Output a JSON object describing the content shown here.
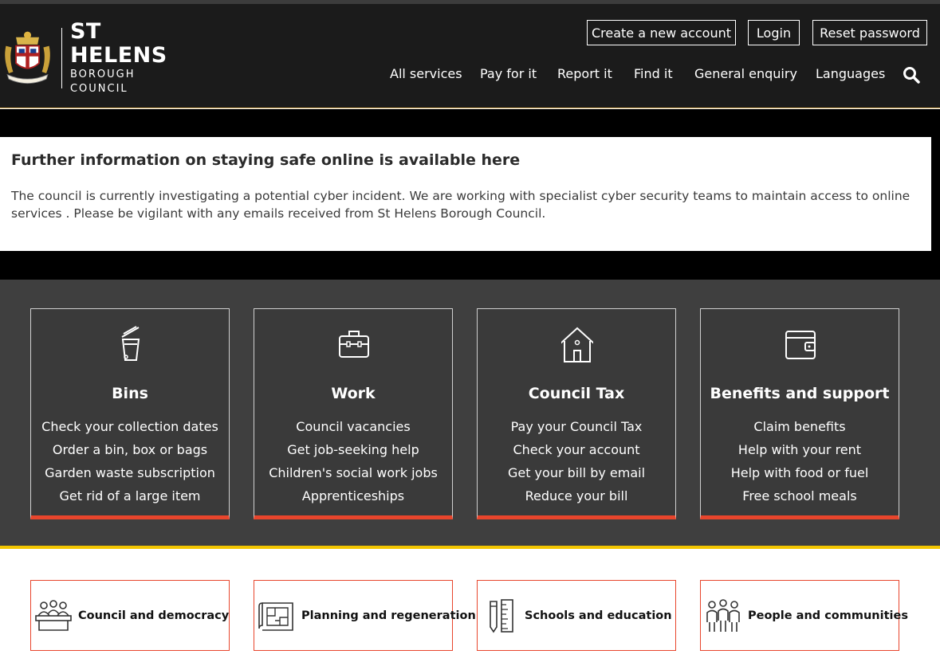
{
  "header": {
    "logo": {
      "name": "ST HELENS",
      "sub": "BOROUGH COUNCIL"
    },
    "account_links": [
      "Create a new account",
      "Login",
      "Reset password"
    ],
    "nav": [
      "All services",
      "Pay for it",
      "Report it",
      "Find it",
      "General enquiry",
      "Languages"
    ],
    "search_icon": "search-icon"
  },
  "alert": {
    "title": "Further information on staying safe online is available here",
    "body": "The council is currently investigating a potential cyber incident. We are working with specialist cyber security teams to maintain access to online services . Please be vigilant with any emails received from St Helens Borough Council."
  },
  "service_cards": [
    {
      "icon": "bin-icon",
      "title": "Bins",
      "links": [
        "Check your collection dates",
        "Order a bin, box or bags",
        "Garden waste subscription",
        "Get rid of a large item"
      ]
    },
    {
      "icon": "briefcase-icon",
      "title": "Work",
      "links": [
        "Council vacancies",
        "Get job-seeking help",
        "Children's social work jobs",
        "Apprenticeships"
      ]
    },
    {
      "icon": "house-icon",
      "title": "Council Tax",
      "links": [
        "Pay your Council Tax",
        "Check your account",
        "Get your bill by email",
        "Reduce your bill"
      ]
    },
    {
      "icon": "wallet-icon",
      "title": "Benefits and support",
      "links": [
        "Claim benefits",
        "Help with your rent",
        "Help with food or fuel",
        "Free school meals"
      ]
    }
  ],
  "topic_tiles": [
    {
      "icon": "council-chamber-icon",
      "label": "Council and democracy"
    },
    {
      "icon": "plan-map-icon",
      "label": "Planning and regeneration"
    },
    {
      "icon": "pencil-ruler-icon",
      "label": "Schools and education"
    },
    {
      "icon": "people-group-icon",
      "label": "People and communities"
    }
  ],
  "colors": {
    "header_bg": "#1b1b1b",
    "services_bg": "#3f3f3f",
    "card_accent": "#e8452c",
    "band_divider": "#f2c500"
  }
}
